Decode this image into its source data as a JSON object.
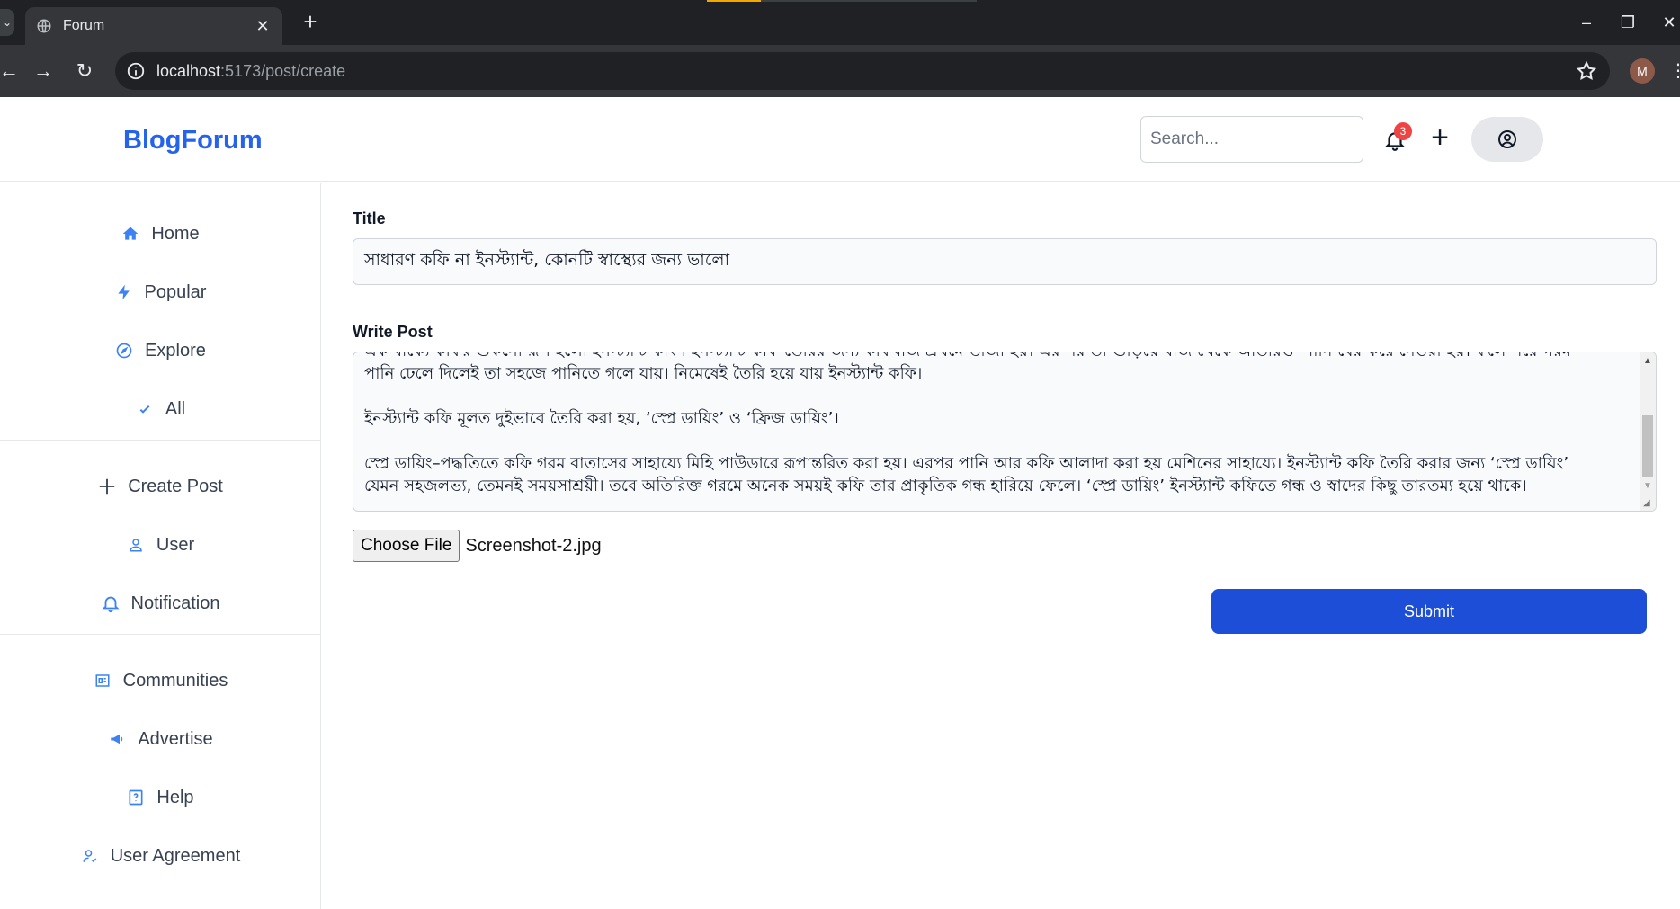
{
  "browser": {
    "tab_title": "Forum",
    "url_host": "localhost",
    "url_path": ":5173/post/create",
    "profile_initial": "M"
  },
  "header": {
    "logo": "BlogForum",
    "search_placeholder": "Search...",
    "notification_count": "3"
  },
  "sidebar": {
    "items": [
      {
        "label": "Home",
        "icon": "home-icon"
      },
      {
        "label": "Popular",
        "icon": "bolt-icon"
      },
      {
        "label": "Explore",
        "icon": "compass-icon"
      },
      {
        "label": "All",
        "icon": "check-icon"
      },
      {
        "label": "Create Post",
        "icon": "plus-icon"
      },
      {
        "label": "User",
        "icon": "user-icon"
      },
      {
        "label": "Notification",
        "icon": "bell-icon"
      },
      {
        "label": "Communities",
        "icon": "communities-icon"
      },
      {
        "label": "Advertise",
        "icon": "megaphone-icon"
      },
      {
        "label": "Help",
        "icon": "help-icon"
      },
      {
        "label": "User Agreement",
        "icon": "user-agreement-icon"
      }
    ]
  },
  "form": {
    "title_label": "Title",
    "title_value": "সাধারণ কফি না ইনস্ট্যান্ট, কোনটি স্বাস্থ্যের জন্য ভালো",
    "post_label": "Write Post",
    "post_value": "এক বাক্যে কফির শুকনো রূপ হলো ইনস্ট্যান্ট কফি। ইনস্ট্যান্ট কফি তৈরির জন্য কফিবীজ প্রথমে ভাজা হয়। এর পর তা গুঁড়িয়ে বীজ থেকে অতিরিক্ত পানি বের করে নেওয়া হয়। ফলে পরে গরম\nপানি ঢেলে দিলেই তা সহজে পানিতে গলে যায়। নিমেষেই তৈরি হয়ে যায় ইনস্ট্যান্ট কফি।\n\nইনস্ট্যান্ট কফি মূলত দুইভাবে তৈরি করা হয়, ‘স্প্রে ডায়িং’ ও ‘ফ্রিজ ডায়িং’।\n\nস্প্রে ডায়িং–পদ্ধতিতে কফি গরম বাতাসের সাহায্যে মিহি পাউডারে রূপান্তরিত করা হয়। এরপর পানি আর কফি আলাদা করা হয় মেশিনের সাহায্যে। ইনস্ট্যান্ট কফি তৈরি করার জন্য ‘স্প্রে ডায়িং’\nযেমন সহজলভ্য, তেমনই সময়সাশ্রয়ী। তবে অতিরিক্ত গরমে অনেক সময়ই কফি তার প্রাকৃতিক গন্ধ হারিয়ে ফেলে। ‘স্প্রে ডায়িং’ ইনস্ট্যান্ট কফিতে গন্ধ ও স্বাদের কিছু তারতম্য হয়ে থাকে।",
    "file_button": "Choose File",
    "file_name": "Screenshot-2.jpg",
    "submit_label": "Submit"
  },
  "colors": {
    "brand": "#2563eb",
    "submit": "#1d4ed8",
    "badge": "#ef4444"
  }
}
